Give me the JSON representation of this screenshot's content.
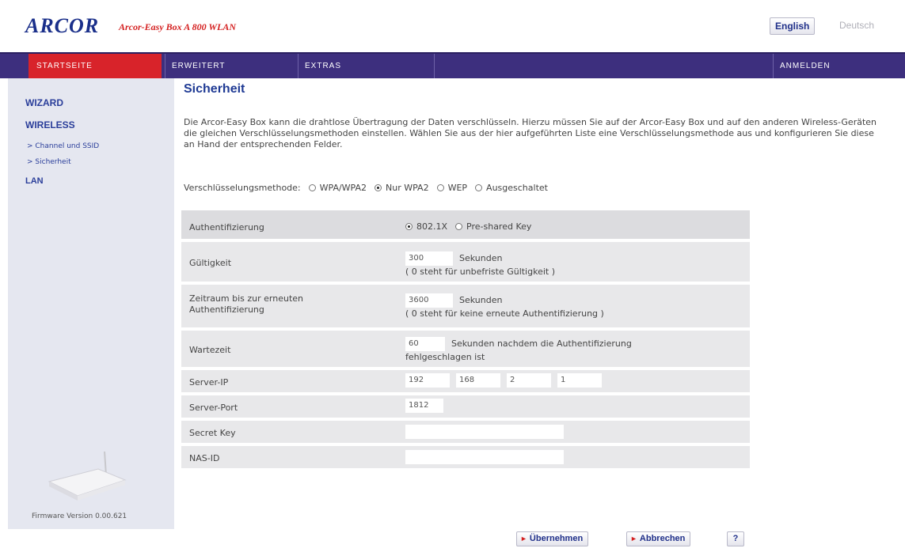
{
  "header": {
    "logo": "ARCOR",
    "logo_sub": "Arcor-Easy Box A 800 WLAN",
    "lang_en": "English",
    "lang_de": "Deutsch"
  },
  "nav": {
    "startseite": "STARTSEITE",
    "erweitert": "ERWEITERT",
    "extras": "EXTRAS",
    "anmelden": "ANMELDEN"
  },
  "sidebar": {
    "wizard": "WIZARD",
    "wireless": "WIRELESS",
    "sub1": "> Channel und SSID",
    "sub2": "> Sicherheit",
    "lan": "LAN",
    "firmware": "Firmware Version 0.00.621"
  },
  "main": {
    "title": "Sicherheit",
    "intro": "Die Arcor-Easy Box kann die drahtlose Übertragung der Daten verschlüsseln. Hierzu müssen Sie auf der Arcor-Easy Box und auf den anderen Wireless-Geräten die gleichen Verschlüsselungsmethoden einstellen. Wählen Sie aus der hier aufgeführten Liste eine Verschlüsselungsmethode aus und konfigurieren Sie diese an Hand der entsprechenden Felder.",
    "enc_label": "Verschlüsselungsmethode:",
    "enc_options": [
      "WPA/WPA2",
      "Nur WPA2",
      "WEP",
      "Ausgeschaltet"
    ]
  },
  "form": {
    "auth_label": "Authentifizierung",
    "auth_opt1": "802.1X",
    "auth_opt2": "Pre-shared Key",
    "gueltigkeit_label": "Gültigkeit",
    "gueltigkeit_value": "300",
    "gueltigkeit_unit": "Sekunden",
    "gueltigkeit_note": "( 0 steht für unbefriste Gültigkeit )",
    "zeitraum_label": "Zeitraum bis zur erneuten Authentifizierung",
    "zeitraum_value": "3600",
    "zeitraum_unit": "Sekunden",
    "zeitraum_note": "( 0 steht für keine erneute Authentifizierung )",
    "wartezeit_label": "Wartezeit",
    "wartezeit_value": "60",
    "wartezeit_unit": "Sekunden nachdem die Authentifizierung",
    "wartezeit_note": "fehlgeschlagen ist",
    "serverip_label": "Server-IP",
    "ip1": "192",
    "ip2": "168",
    "ip3": "2",
    "ip4": "1",
    "serverport_label": "Server-Port",
    "serverport_value": "1812",
    "secret_label": "Secret Key",
    "nas_label": "NAS-ID"
  },
  "buttons": {
    "ok": "Übernehmen",
    "cancel": "Abbrechen",
    "help": "?"
  }
}
